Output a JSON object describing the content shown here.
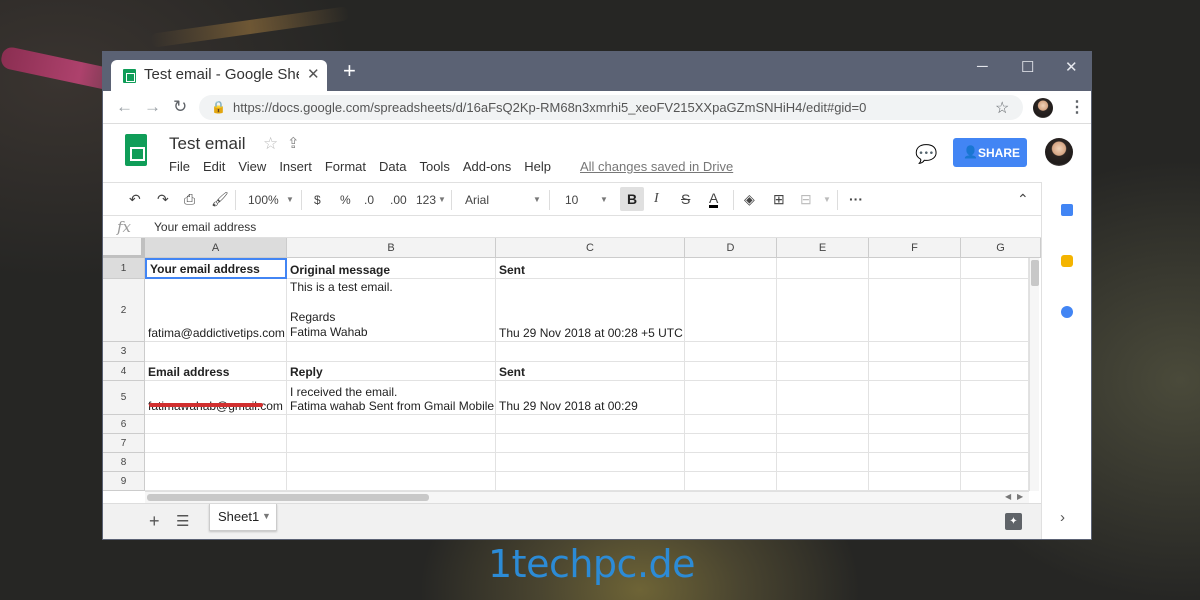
{
  "browser": {
    "tab_title": "Test email - Google Sheets",
    "tab_close": "✕",
    "new_tab": "+",
    "url": "https://docs.google.com/spreadsheets/d/16aFsQ2Kp-RM68n3xmrhi5_xeoFV215XXpaGZmSNHiH4/edit#gid=0"
  },
  "doc": {
    "title": "Test email",
    "menu": [
      "File",
      "Edit",
      "View",
      "Insert",
      "Format",
      "Data",
      "Tools",
      "Add-ons",
      "Help"
    ],
    "save_status": "All changes saved in Drive",
    "share_label": "SHARE"
  },
  "toolbar": {
    "zoom": "100%",
    "currency": "$",
    "percent": "%",
    "dec_decrease": ".0",
    "dec_increase": ".00",
    "more_formats": "123",
    "font": "Arial",
    "font_size": "10",
    "bold": "B",
    "italic": "I",
    "strike": "S",
    "text_color": "A"
  },
  "formula_bar": {
    "label": "fx",
    "value": "Your email address"
  },
  "grid": {
    "columns": [
      "A",
      "B",
      "C",
      "D",
      "E",
      "F",
      "G"
    ],
    "rows": [
      "1",
      "2",
      "3",
      "4",
      "5",
      "6",
      "7",
      "8",
      "9"
    ],
    "cells": {
      "A1": "Your email address",
      "B1": "Original message",
      "C1": "Sent",
      "A2": "fatima@addictivetips.com",
      "B2": "This is a test email.\n\nRegards\nFatima Wahab",
      "C2": "Thu 29 Nov 2018 at 00:28 +5 UTC",
      "A4": "Email address",
      "B4": "Reply",
      "C4": "Sent",
      "A5": "fatimawahab@gmail.com",
      "B5": "I received the email.\nFatima wahab Sent from Gmail Mobile",
      "C5": "Thu 29 Nov 2018 at 00:29"
    }
  },
  "sheets": {
    "add": "+",
    "active": "Sheet1"
  },
  "watermark": "1techpc.de"
}
